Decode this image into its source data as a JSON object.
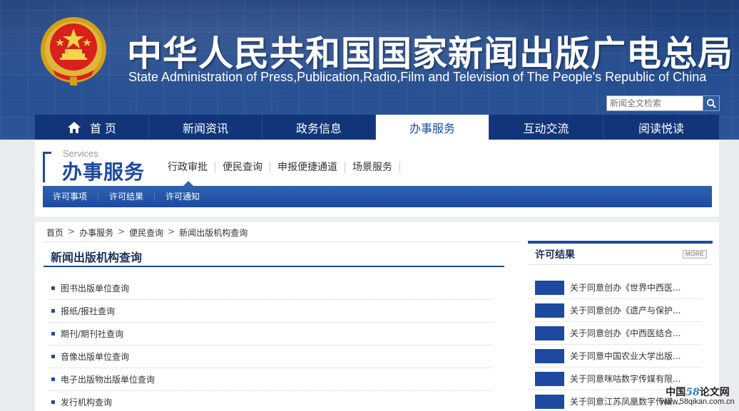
{
  "header": {
    "title_cn": "中华人民共和国国家新闻出版广电总局",
    "title_en": "State Administration of Press,Publication,Radio,Film and Television of The People's Republic of China",
    "search_placeholder": "新闻全文检索",
    "emblem_icon": "national-emblem-icon",
    "search_icon": "magnifier-icon"
  },
  "nav": {
    "items": [
      {
        "label": "首 页",
        "icon": "home-icon"
      },
      {
        "label": "新闻资讯"
      },
      {
        "label": "政务信息"
      },
      {
        "label": "办事服务",
        "active": true
      },
      {
        "label": "互动交流"
      },
      {
        "label": "阅读悦读"
      }
    ]
  },
  "section": {
    "en": "Services",
    "cn": "办事服务",
    "subnav": [
      "行政审批",
      "便民查询",
      "申报便捷通道",
      "场景服务"
    ],
    "bar": [
      "许可事项",
      "许可结果",
      "许可通知"
    ]
  },
  "breadcrumb": [
    "首页",
    "办事服务",
    "便民查询",
    "新闻出版机构查询"
  ],
  "breadcrumb_sep": ">",
  "main": {
    "title": "新闻出版机构查询",
    "items": [
      "图书出版单位查询",
      "报纸/报社查询",
      "期刊/期刊社查询",
      "音像出版单位查询",
      "电子出版物出版单位查询",
      "发行机构查询"
    ]
  },
  "sidebar": {
    "title": "许可结果",
    "more": "MORE",
    "items": [
      "关于同意创办《世界中西医...",
      "关于同意创办《遗产与保护...",
      "关于同意创办《中西医结合...",
      "关于同意中国农业大学出版...",
      "关于同意咪咕数字传媒有限...",
      "关于同意江苏凤凰数字传媒..."
    ]
  },
  "watermark": {
    "line1_a": "中国",
    "line1_num": "58",
    "line1_b": "论文网",
    "line2": "www.58qikan.com.cn"
  },
  "colors": {
    "primary": "#1d4aa0",
    "nav_bg": "#12357a",
    "header_bg": "#254d8f"
  }
}
